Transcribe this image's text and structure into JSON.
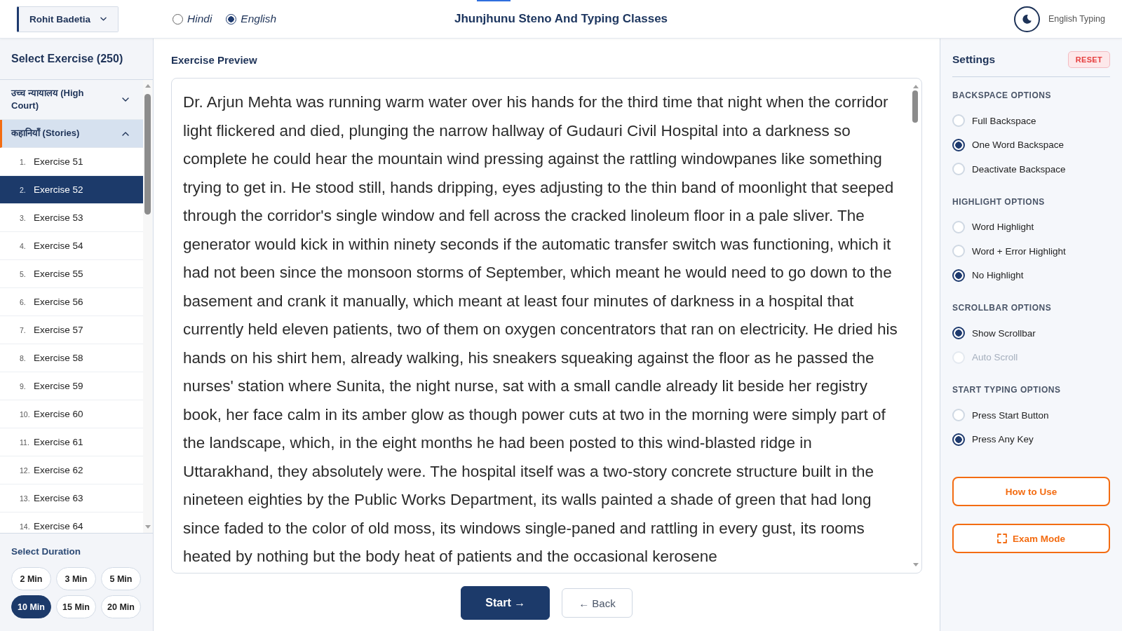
{
  "header": {
    "user_menu": "Rohit Badetia",
    "language_options": [
      {
        "label": "Hindi",
        "selected": false
      },
      {
        "label": "English",
        "selected": true
      }
    ],
    "title": "Jhunjhunu Steno And Typing Classes",
    "mode_label": "English Typing"
  },
  "exercise_sidebar": {
    "title": "Select Exercise (250)",
    "categories": [
      {
        "label": "उच्च न्यायालय (High Court)",
        "expanded": false
      },
      {
        "label": "कहानियाँ (Stories)",
        "expanded": true,
        "children": [
          {
            "number": "1.",
            "label": "Exercise 51",
            "selected": false
          },
          {
            "number": "2.",
            "label": "Exercise 52",
            "selected": true
          },
          {
            "number": "3.",
            "label": "Exercise 53",
            "selected": false
          },
          {
            "number": "4.",
            "label": "Exercise 54",
            "selected": false
          },
          {
            "number": "5.",
            "label": "Exercise 55",
            "selected": false
          },
          {
            "number": "6.",
            "label": "Exercise 56",
            "selected": false
          },
          {
            "number": "7.",
            "label": "Exercise 57",
            "selected": false
          },
          {
            "number": "8.",
            "label": "Exercise 58",
            "selected": false
          },
          {
            "number": "9.",
            "label": "Exercise 59",
            "selected": false
          },
          {
            "number": "10.",
            "label": "Exercise 60",
            "selected": false
          },
          {
            "number": "11.",
            "label": "Exercise 61",
            "selected": false
          },
          {
            "number": "12.",
            "label": "Exercise 62",
            "selected": false
          },
          {
            "number": "13.",
            "label": "Exercise 63",
            "selected": false
          },
          {
            "number": "14.",
            "label": "Exercise 64",
            "selected": false
          }
        ]
      }
    ],
    "duration": {
      "title": "Select Duration",
      "options": [
        {
          "label": "2 Min",
          "selected": false
        },
        {
          "label": "3 Min",
          "selected": false
        },
        {
          "label": "5 Min",
          "selected": false
        },
        {
          "label": "10 Min",
          "selected": true
        },
        {
          "label": "15 Min",
          "selected": false
        },
        {
          "label": "20 Min",
          "selected": false
        }
      ]
    }
  },
  "preview": {
    "title": "Exercise Preview",
    "text": "Dr. Arjun Mehta was running warm water over his hands for the third time that night when the corridor light flickered and died, plunging the narrow hallway of Gudauri Civil Hospital into a darkness so complete he could hear the mountain wind pressing against the rattling windowpanes like something trying to get in. He stood still, hands dripping, eyes adjusting to the thin band of moonlight that seeped through the corridor's single window and fell across the cracked linoleum floor in a pale sliver. The generator would kick in within ninety seconds if the automatic transfer switch was functioning, which it had not been since the monsoon storms of September, which meant he would need to go down to the basement and crank it manually, which meant at least four minutes of darkness in a hospital that currently held eleven patients, two of them on oxygen concentrators that ran on electricity. He dried his hands on his shirt hem, already walking, his sneakers squeaking against the floor as he passed the nurses' station where Sunita, the night nurse, sat with a small candle already lit beside her registry book, her face calm in its amber glow as though power cuts at two in the morning were simply part of the landscape, which, in the eight months he had been posted to this wind-blasted ridge in Uttarakhand, they absolutely were. The hospital itself was a two-story concrete structure built in the nineteen eighties by the Public Works Department, its walls painted a shade of green that had long since faded to the color of old moss, its windows single-paned and rattling in every gust, its rooms heated by nothing but the body heat of patients and the occasional kerosene"
  },
  "actions": [
    {
      "label": "Start →",
      "kind": "primary"
    },
    {
      "label": "← Back",
      "kind": "secondary"
    }
  ],
  "settings": {
    "title": "Settings",
    "reset_label": "RESET",
    "groups": [
      {
        "title": "BACKSPACE OPTIONS",
        "options": [
          {
            "label": "Full Backspace",
            "selected": false,
            "disabled": false
          },
          {
            "label": "One Word Backspace",
            "selected": true,
            "disabled": false
          },
          {
            "label": "Deactivate Backspace",
            "selected": false,
            "disabled": false
          }
        ]
      },
      {
        "title": "HIGHLIGHT OPTIONS",
        "options": [
          {
            "label": "Word Highlight",
            "selected": false,
            "disabled": false
          },
          {
            "label": "Word + Error Highlight",
            "selected": false,
            "disabled": false
          },
          {
            "label": "No Highlight",
            "selected": true,
            "disabled": false
          }
        ]
      },
      {
        "title": "SCROLLBAR OPTIONS",
        "options": [
          {
            "label": "Show Scrollbar",
            "selected": true,
            "disabled": false
          },
          {
            "label": "Auto Scroll",
            "selected": false,
            "disabled": true
          }
        ]
      },
      {
        "title": "START TYPING OPTIONS",
        "options": [
          {
            "label": "Press Start Button",
            "selected": false,
            "disabled": false
          },
          {
            "label": "Press Any Key",
            "selected": true,
            "disabled": false
          }
        ]
      }
    ],
    "buttons": [
      {
        "label": "How to Use",
        "kind": "help"
      },
      {
        "label": "Exam Mode",
        "kind": "fullscreen"
      }
    ]
  }
}
